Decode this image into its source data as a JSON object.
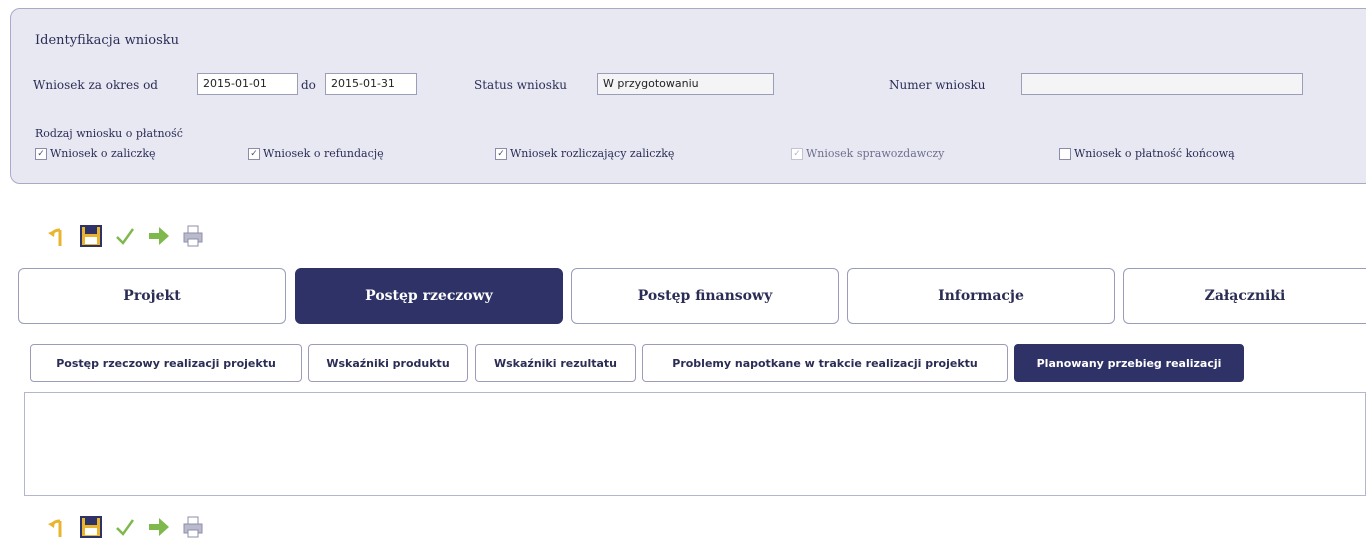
{
  "identification": {
    "title": "Identyfikacja wniosku",
    "period_label": "Wniosek za okres od",
    "date_from": "2015-01-01",
    "to_label": "do",
    "date_to": "2015-01-31",
    "status_label": "Status wniosku",
    "status_value": "W przygotowaniu",
    "number_label": "Numer wniosku",
    "number_value": "",
    "payment_type_label": "Rodzaj wniosku o płatność",
    "checkboxes": [
      {
        "label": "Wniosek o zaliczkę",
        "checked": true,
        "enabled": true
      },
      {
        "label": "Wniosek o refundację",
        "checked": true,
        "enabled": true
      },
      {
        "label": "Wniosek rozliczający zaliczkę",
        "checked": true,
        "enabled": true
      },
      {
        "label": "Wniosek sprawozdawczy",
        "checked": true,
        "enabled": false
      },
      {
        "label": "Wniosek o płatność końcową",
        "checked": false,
        "enabled": true
      }
    ]
  },
  "toolbar_icons": [
    "undo-icon",
    "save-icon",
    "check-icon",
    "submit-arrow-icon",
    "print-icon"
  ],
  "main_tabs": [
    {
      "label": "Projekt",
      "active": false
    },
    {
      "label": "Postęp rzeczowy",
      "active": true
    },
    {
      "label": "Postęp finansowy",
      "active": false
    },
    {
      "label": "Informacje",
      "active": false
    },
    {
      "label": "Załączniki",
      "active": false
    }
  ],
  "sub_tabs": [
    {
      "label": "Postęp rzeczowy realizacji projektu",
      "active": false
    },
    {
      "label": "Wskaźniki produktu",
      "active": false
    },
    {
      "label": "Wskaźniki rezultatu",
      "active": false
    },
    {
      "label": "Problemy napotkane w trakcie realizacji projektu",
      "active": false
    },
    {
      "label": "Planowany przebieg realizacji",
      "active": true
    }
  ],
  "content_text": "",
  "colors": {
    "accent": "#2e3266",
    "panel_bg": "#e8e8f3",
    "border": "#9b9db8"
  }
}
